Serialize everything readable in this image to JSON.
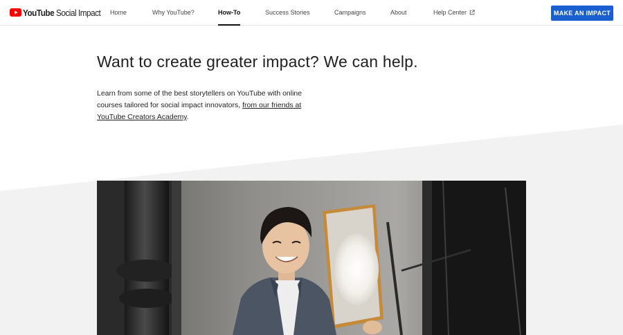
{
  "header": {
    "logo": {
      "brand": "YouTube",
      "suffix": "Social Impact",
      "icon": "youtube-play-icon",
      "brand_color": "#ff0000"
    },
    "nav": [
      {
        "label": "Home",
        "active": false
      },
      {
        "label": "Why YouTube?",
        "active": false
      },
      {
        "label": "How-To",
        "active": true
      },
      {
        "label": "Success Stories",
        "active": false
      },
      {
        "label": "Campaigns",
        "active": false
      },
      {
        "label": "About",
        "active": false
      },
      {
        "label": "Help Center",
        "active": false,
        "icon": "external-link-icon"
      }
    ],
    "cta_label": "MAKE AN IMPACT",
    "cta_color": "#1a5fd0"
  },
  "main": {
    "headline": "Want to create greater impact? We can help.",
    "intro_text": "Learn from some of the best storytellers on YouTube with online courses tailored for social impact innovators, ",
    "intro_link": "from our friends at YouTube Creators Academy",
    "intro_end": "."
  },
  "colors": {
    "background": "#ffffff",
    "band": "#f2f2f2",
    "text": "#212121"
  }
}
